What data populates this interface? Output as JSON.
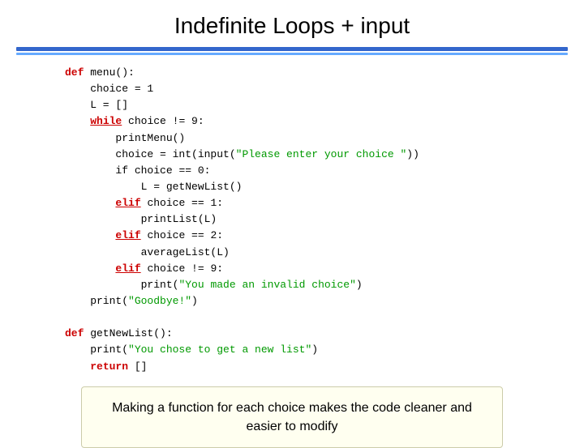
{
  "page": {
    "title": "Indefinite Loops + input",
    "note": "Making a function for each choice makes the code\ncleaner and easier to modify"
  },
  "code": {
    "lines": []
  }
}
